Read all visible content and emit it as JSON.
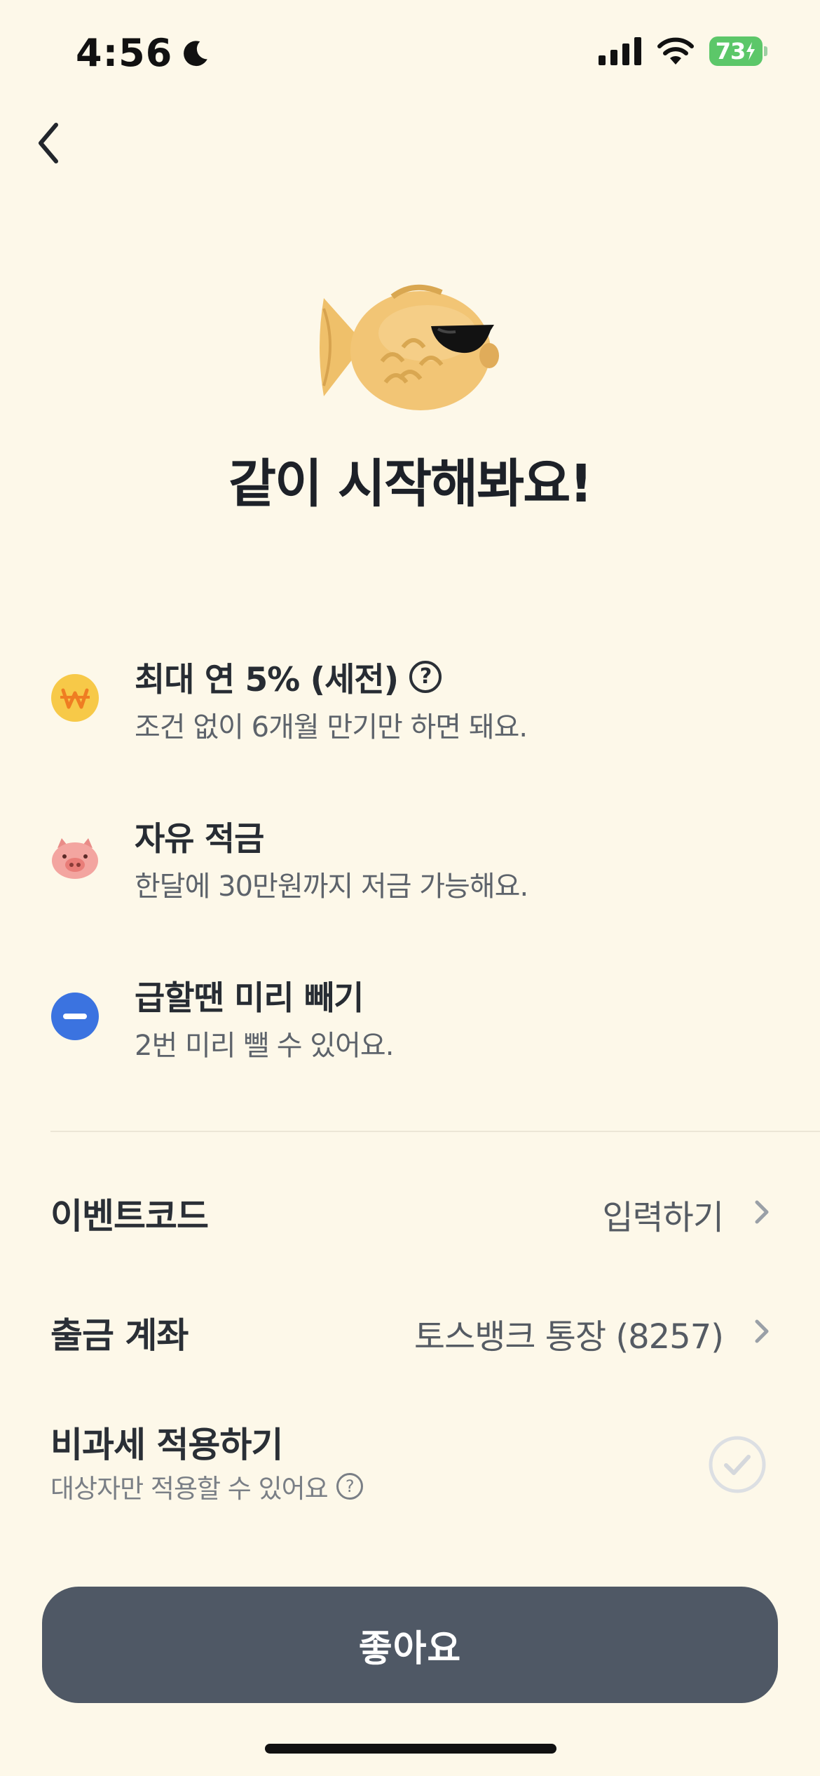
{
  "status_bar": {
    "time": "4:56",
    "battery": "73",
    "icons": [
      "moon-icon",
      "signal-icon",
      "wifi-icon",
      "battery-icon"
    ]
  },
  "header": {
    "back_icon": "chevron-left-icon"
  },
  "hero": {
    "image": "fish-pastry-sunglasses",
    "headline": "같이 시작해봐요!"
  },
  "features": [
    {
      "icon": "won-coin-icon",
      "title": "최대 연 5% (세전)",
      "help_icon": "question-circle-icon",
      "help_text": "?",
      "subtitle": "조건 없이 6개월 만기만 하면 돼요."
    },
    {
      "icon": "piggy-icon",
      "title": "자유 적금",
      "subtitle": "한달에 30만원까지 저금 가능해요."
    },
    {
      "icon": "minus-circle-icon",
      "title": "급할땐 미리 빼기",
      "subtitle": "2번 미리 뺄 수 있어요."
    }
  ],
  "settings": {
    "event_code": {
      "label": "이벤트코드",
      "value": "입력하기"
    },
    "withdraw_account": {
      "label": "출금 계좌",
      "value": "토스뱅크 통장 (8257)"
    },
    "tax_free": {
      "label": "비과세 적용하기",
      "sub": "대상자만 적용할 수 있어요",
      "help_text": "?",
      "checked": false
    }
  },
  "cta": {
    "label": "좋아요"
  },
  "colors": {
    "background": "#fdf8e9",
    "button": "#4f5865",
    "coin": "#f7c948",
    "won": "#ef7d22",
    "pig": "#f3a5a0",
    "minus": "#3b73e0",
    "battery": "#5cc769"
  }
}
